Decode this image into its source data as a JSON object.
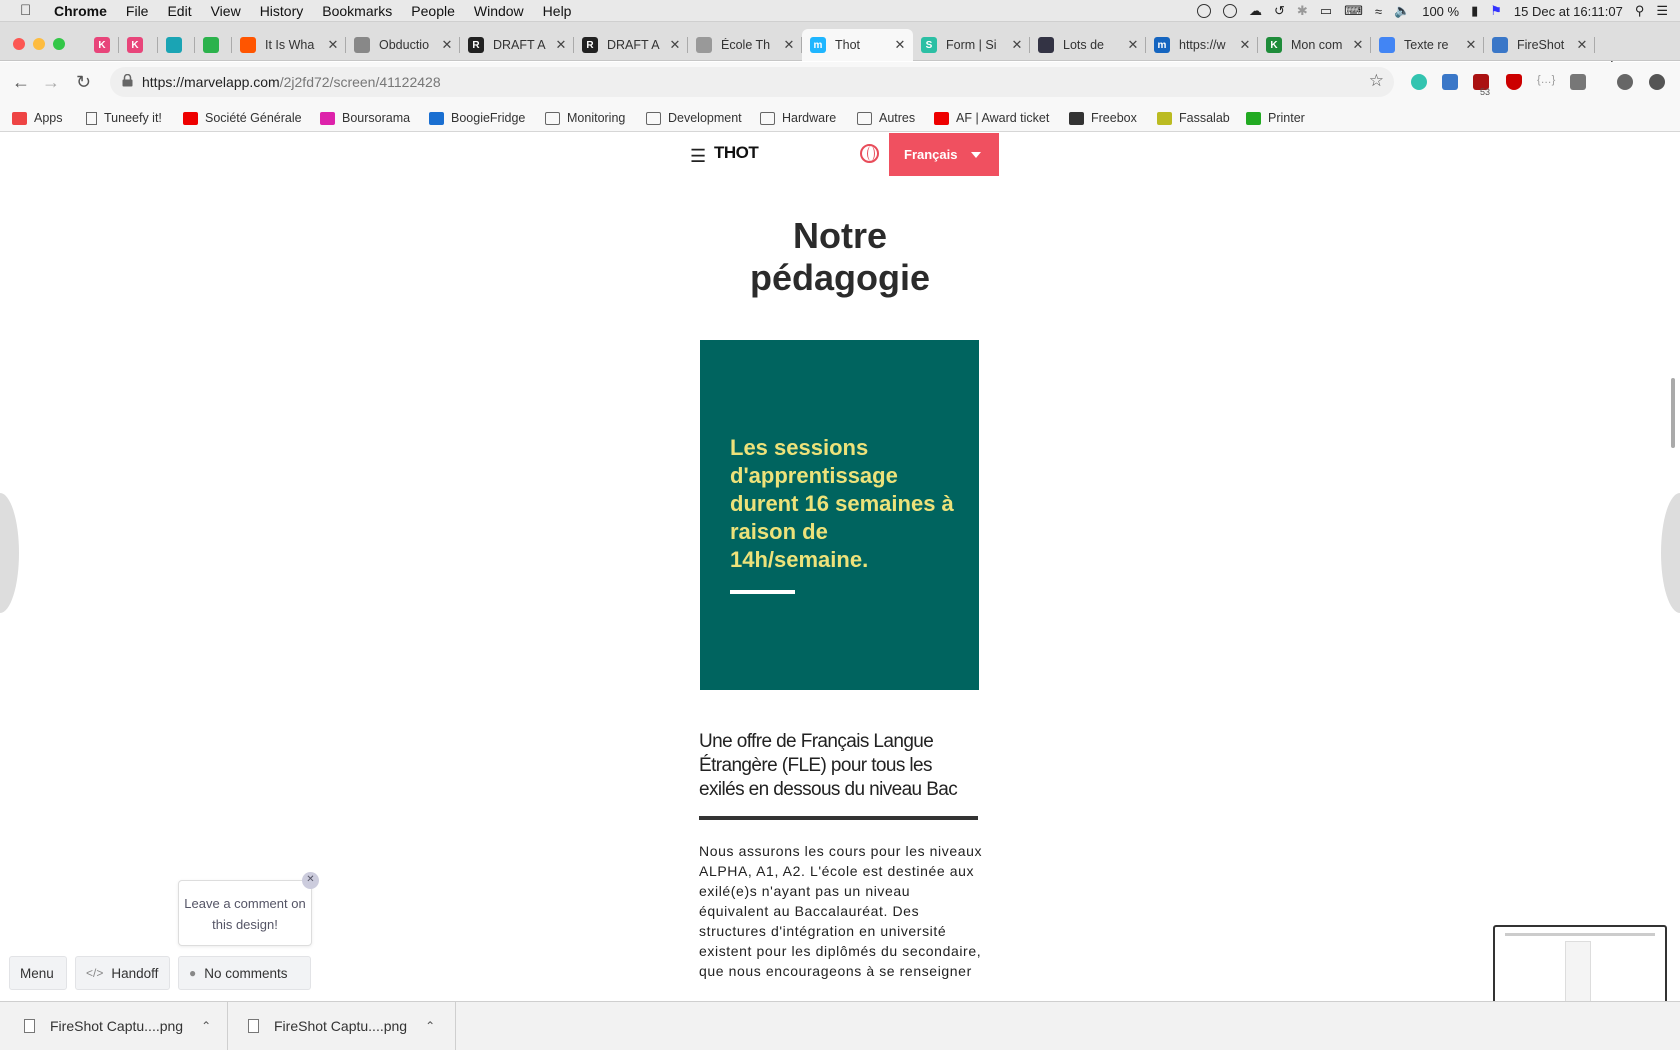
{
  "menubar": {
    "apple_icon": "apple-icon",
    "items": [
      "Chrome",
      "File",
      "Edit",
      "View",
      "History",
      "Bookmarks",
      "People",
      "Window",
      "Help"
    ],
    "battery": "100 %",
    "datetime": "15 Dec at  16:11:07"
  },
  "tabs": [
    {
      "title": "",
      "favicon": "k-icon",
      "color": "#e8457a",
      "letter": "K"
    },
    {
      "title": "",
      "favicon": "k-icon",
      "color": "#e8457a",
      "letter": "K"
    },
    {
      "title": "",
      "favicon": "trello-icon",
      "color": "#1aa4b4",
      "letter": ""
    },
    {
      "title": "",
      "favicon": "trello-icon",
      "color": "#2bb24c",
      "letter": ""
    },
    {
      "title": "It Is Wha",
      "favicon": "soundcloud-icon",
      "color": "#ff5500",
      "letter": ""
    },
    {
      "title": "Obductio",
      "favicon": "diamond-icon",
      "color": "#888888",
      "letter": ""
    },
    {
      "title": "DRAFT A",
      "favicon": "r-icon",
      "color": "#222222",
      "letter": "R"
    },
    {
      "title": "DRAFT A",
      "favicon": "r-icon",
      "color": "#222222",
      "letter": "R"
    },
    {
      "title": "École Th",
      "favicon": "doc-icon",
      "color": "#999999",
      "letter": ""
    },
    {
      "title": "Thot",
      "favicon": "marvel-icon",
      "color": "#1fb6ff",
      "letter": "m",
      "active": true
    },
    {
      "title": "Form | Si",
      "favicon": "s-icon",
      "color": "#2bbfa4",
      "letter": "S"
    },
    {
      "title": "Lots de",
      "favicon": "eye-icon",
      "color": "#334",
      "letter": ""
    },
    {
      "title": "https://w",
      "favicon": "m-icon",
      "color": "#1565c0",
      "letter": "m"
    },
    {
      "title": "Mon com",
      "favicon": "k-icon",
      "color": "#1e8c3a",
      "letter": "K"
    },
    {
      "title": "Texte re",
      "favicon": "docs-icon",
      "color": "#4285f4",
      "letter": ""
    },
    {
      "title": "FireShot",
      "favicon": "fireshot-icon",
      "color": "#3a77c8",
      "letter": ""
    }
  ],
  "toolbar": {
    "url_host": "https://marvelapp.com",
    "url_path": "/2j2fd72/screen/41122428",
    "badge": "53"
  },
  "bookmarks": [
    {
      "label": "Apps",
      "icon": "apps-grid-icon"
    },
    {
      "label": "Tuneefy it!",
      "icon": "page-icon"
    },
    {
      "label": "Société Générale",
      "icon": "sg-icon"
    },
    {
      "label": "Boursorama",
      "icon": "boursorama-icon"
    },
    {
      "label": "BoogieFridge",
      "icon": "dsm-icon"
    },
    {
      "label": "Monitoring",
      "icon": "folder-icon"
    },
    {
      "label": "Development",
      "icon": "folder-icon"
    },
    {
      "label": "Hardware",
      "icon": "folder-icon"
    },
    {
      "label": "Autres",
      "icon": "folder-icon"
    },
    {
      "label": "AF | Award ticket",
      "icon": "af-icon"
    },
    {
      "label": "Freebox",
      "icon": "freebox-icon"
    },
    {
      "label": "Fassalab",
      "icon": "fassalab-icon"
    },
    {
      "label": "Printer",
      "icon": "printer-icon"
    }
  ],
  "site": {
    "logo": "THOT",
    "language": "Français",
    "heading": "Notre pédagogie",
    "card_text": "Les sessions d'apprentissage durent 16 semaines à raison de 14h/semaine.",
    "subtitle": "Une offre de Français Langue Étrangère (FLE) pour tous les exilés en dessous du niveau Bac",
    "body": "Nous assurons les cours pour les niveaux ALPHA, A1, A2.  L'école est destinée aux exilé(e)s n'ayant pas un niveau équivalent au Baccalauréat. Des structures d'intégration en université existent pour les diplômés du secondaire, que nous encourageons à se renseigner",
    "colors": {
      "accent": "#f05060",
      "card_bg": "#00645f",
      "card_text": "#ede27a"
    }
  },
  "marvel": {
    "tooltip": "Leave a comment on this design!",
    "menu_label": "Menu",
    "handoff_label": "Handoff",
    "comments_label": "No comments"
  },
  "downloads": [
    {
      "name": "FireShot Captu....png"
    },
    {
      "name": "FireShot Captu....png"
    }
  ]
}
